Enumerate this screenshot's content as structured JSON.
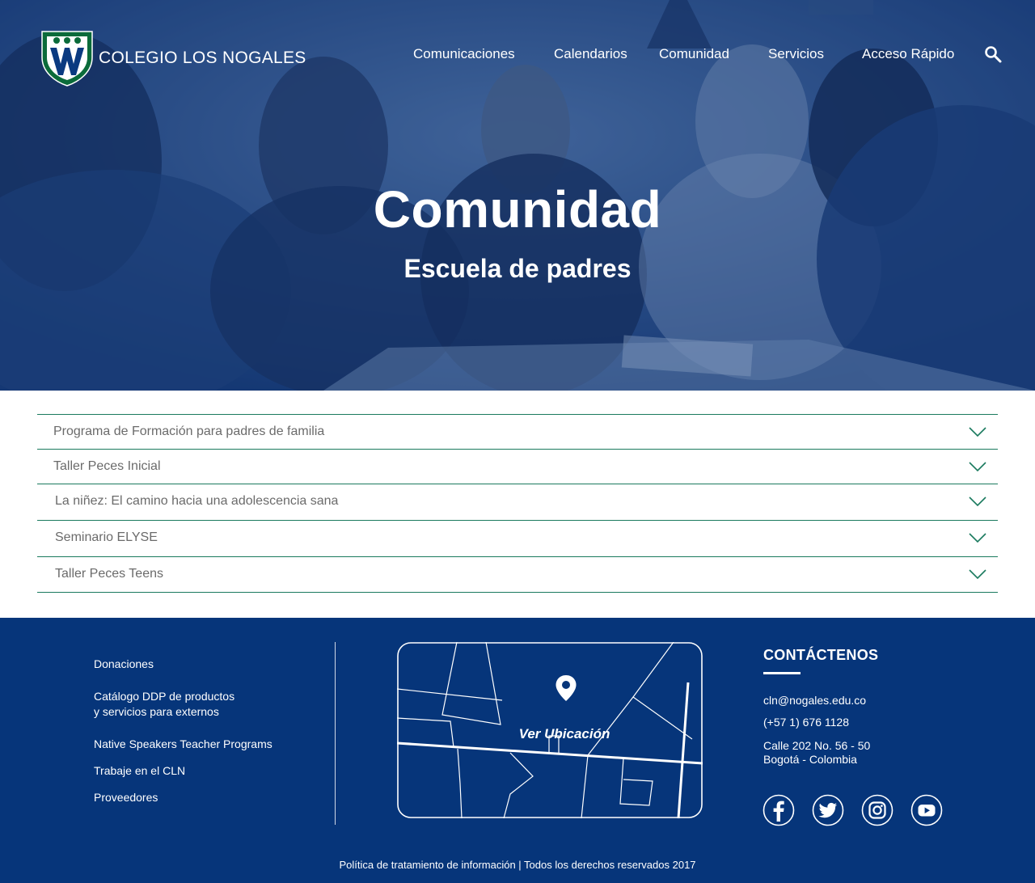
{
  "header": {
    "brand": "COLEGIO LOS NOGALES",
    "nav": [
      "Comunicaciones",
      "Calendarios",
      "Comunidad",
      "Servicios",
      "Acceso Rápido"
    ]
  },
  "hero": {
    "title": "Comunidad",
    "subtitle": "Escuela de padres"
  },
  "accordion": {
    "items": [
      "Programa de Formación para padres de familia",
      "Taller Peces Inicial",
      "La niñez: El camino hacia una adolescencia sana",
      "Seminario ELYSE",
      "Taller Peces Teens"
    ]
  },
  "footer": {
    "links": [
      "Donaciones",
      "Catálogo DDP de productos\ny servicios para externos",
      "Native Speakers Teacher Programs",
      "Trabaje en el CLN",
      "Proveedores"
    ],
    "map_label": "Ver Ubicación",
    "contact": {
      "heading": "CONTÁCTENOS",
      "email": "cln@nogales.edu.co",
      "phone": "(+57 1) 676 1128",
      "address_line1": "Calle 202 No. 56 - 50",
      "address_line2": "Bogotá - Colombia"
    },
    "legal": "Política de tratamiento de información | Todos los derechos reservados 2017"
  },
  "colors": {
    "footer_bg": "#06357a",
    "accent_green": "#1a7a5e",
    "hero_tint": "#1b3f79"
  },
  "icons": [
    "search-icon",
    "chevron-down-icon",
    "map-pin-icon",
    "facebook-icon",
    "twitter-icon",
    "instagram-icon",
    "youtube-icon"
  ]
}
